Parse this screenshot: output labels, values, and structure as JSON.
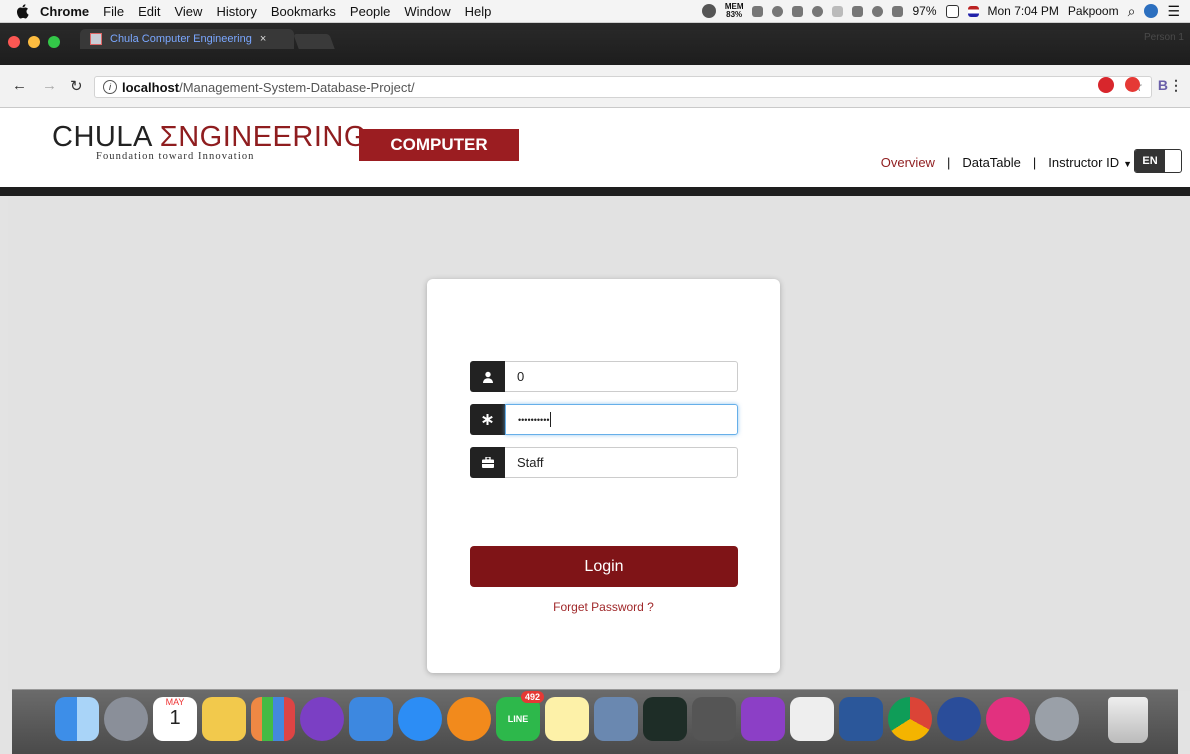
{
  "menubar": {
    "app": "Chrome",
    "items": [
      "File",
      "Edit",
      "View",
      "History",
      "Bookmarks",
      "People",
      "Window",
      "Help"
    ],
    "mem_label": "MEM",
    "mem_value": "83%",
    "battery": "97%",
    "clock": "Mon 7:04 PM",
    "user": "Pakpoom"
  },
  "browser": {
    "tab_title": "Chula Computer Engineering",
    "tab_close": "×",
    "profile": "Person 1",
    "url_host": "localhost",
    "url_path": "/Management-System-Database-Project/"
  },
  "site": {
    "logo_main_a": "CHULA ",
    "logo_main_b": "ΣNGINEERING",
    "logo_tagline": "Foundation toward Innovation",
    "badge": "COMPUTER",
    "nav": {
      "overview": "Overview",
      "datatable": "DataTable",
      "instructor": "Instructor ID",
      "lang": "EN"
    }
  },
  "login": {
    "id_value": "0",
    "password_value": "••••••••••",
    "role_value": "Staff",
    "login_label": "Login",
    "forgot_label": "Forget Password ?"
  },
  "dock": {
    "calendar_month": "MAY",
    "calendar_day": "1",
    "line_badge": "492",
    "line_label": "LINE"
  }
}
